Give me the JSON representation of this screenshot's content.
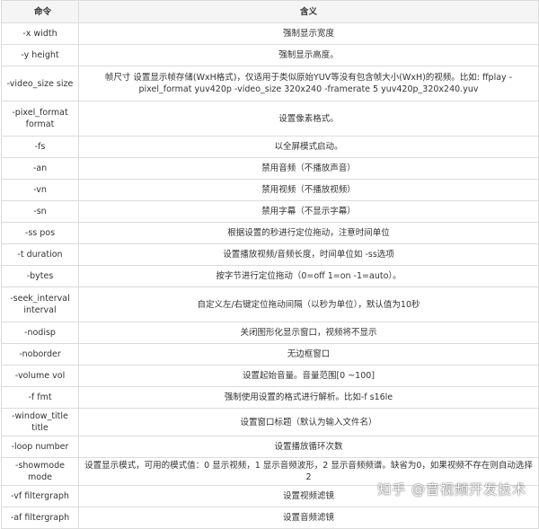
{
  "header": {
    "col1": "命令",
    "col2": "含义"
  },
  "rows": [
    {
      "cmd": "-x width",
      "desc": "强制显示宽度",
      "tall": false
    },
    {
      "cmd": "-y height",
      "desc": "强制显示高度。",
      "tall": false
    },
    {
      "cmd": "-video_size size",
      "desc": "帧尺寸 设置显示帧存储(WxH格式)，仅适用于类似原始YUV等没有包含帧大小(WxH)的视频。比如: ffplay -pixel_format yuv420p -video_size 320x240 -framerate 5 yuv420p_320x240.yuv",
      "tall": true
    },
    {
      "cmd": "-pixel_format format",
      "desc": "设置像素格式。",
      "tall": true
    },
    {
      "cmd": "-fs",
      "desc": "以全屏模式启动。",
      "tall": false
    },
    {
      "cmd": "-an",
      "desc": "禁用音频（不播放声音）",
      "tall": false
    },
    {
      "cmd": "-vn",
      "desc": "禁用视频（不播放视频）",
      "tall": false
    },
    {
      "cmd": "-sn",
      "desc": "禁用字幕（不显示字幕）",
      "tall": false
    },
    {
      "cmd": "-ss pos",
      "desc": "根据设置的秒进行定位拖动，注意时间单位",
      "tall": false
    },
    {
      "cmd": "-t duration",
      "desc": "设置播放视频/音频长度，时间单位如 -ss选项",
      "tall": false
    },
    {
      "cmd": "-bytes",
      "desc": "按字节进行定位拖动（0=off 1=on -1=auto）。",
      "tall": false
    },
    {
      "cmd": "-seek_interval interval",
      "desc": "自定义左/右键定位拖动间隔（以秒为单位），默认值为10秒",
      "tall": true
    },
    {
      "cmd": "-nodisp",
      "desc": "关闭图形化显示窗口，视频将不显示",
      "tall": false
    },
    {
      "cmd": "-noborder",
      "desc": "无边框窗口",
      "tall": false
    },
    {
      "cmd": "-volume vol",
      "desc": "设置起始音量。音量范围[0 ~100]",
      "tall": false
    },
    {
      "cmd": "-f fmt",
      "desc": "强制使用设置的格式进行解析。比如-f s16le",
      "tall": false
    },
    {
      "cmd": "-window_title title",
      "desc": "设置窗口标题（默认为输入文件名）",
      "tall": false
    },
    {
      "cmd": "-loop number",
      "desc": "设置播放循环次数",
      "tall": false
    },
    {
      "cmd": "-showmode mode",
      "desc": "设置显示模式，可用的模式值：0 显示视频，1 显示音频波形，2 显示音频频谱。缺省为0，如果视频不存在则自动选择2",
      "tall": false
    },
    {
      "cmd": "-vf filtergraph",
      "desc": "设置视频滤镜",
      "tall": false
    },
    {
      "cmd": "-af filtergraph",
      "desc": "设置音频滤镜",
      "tall": false
    }
  ],
  "watermark": "知乎 @音视频开发技术"
}
